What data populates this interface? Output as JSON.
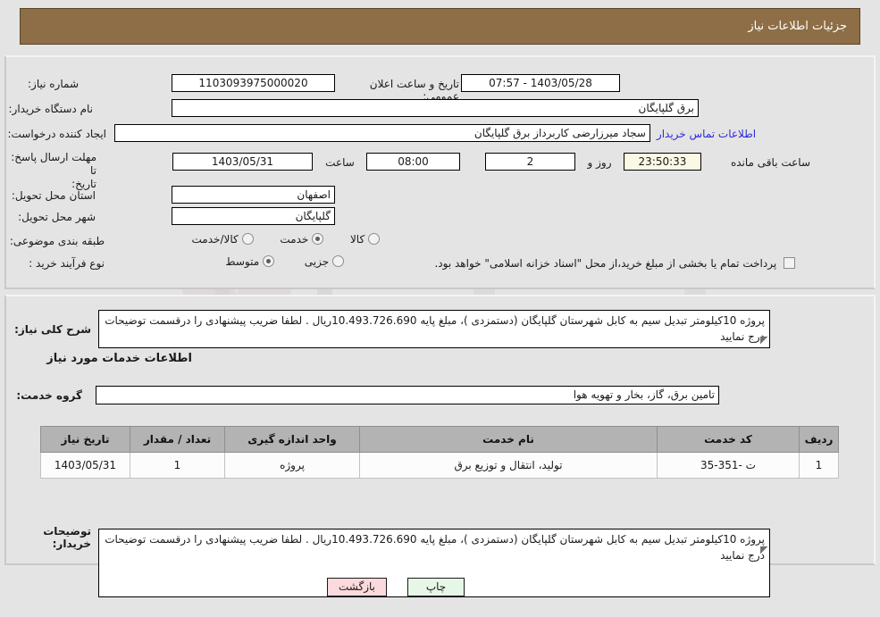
{
  "header": {
    "title": "جزئیات اطلاعات نیاز",
    "bar_color": "#8d6e46"
  },
  "form": {
    "need_number_label": "شماره نیاز:",
    "need_number_value": "1103093975000020",
    "public_announce_label": "تاریخ و ساعت اعلان عمومی:",
    "public_announce_value": "1403/05/28 - 07:57",
    "buyer_org_label": "نام دستگاه خریدار:",
    "buyer_org_value": "برق گلپایگان",
    "requester_label": "ایجاد کننده درخواست:",
    "requester_value": "سجاد میرزارضی کاربرداز برق گلپایگان",
    "buyer_contact_link": "اطلاعات تماس خریدار",
    "deadline_label_line1": "مهلت ارسال پاسخ: تا",
    "deadline_label_line2": "تاریخ:",
    "deadline_date": "1403/05/31",
    "hour_label": "ساعت",
    "deadline_time": "08:00",
    "days_value": "2",
    "days_label": "روز و",
    "countdown_value": "23:50:33",
    "countdown_label": "ساعت باقی مانده",
    "province_label": "استان محل تحویل:",
    "province_value": "اصفهان",
    "city_label": "شهر محل تحویل:",
    "city_value": "گلپایگان",
    "category_label": "طبقه بندی موضوعی:",
    "category_options": [
      {
        "label": "کالا",
        "selected": false
      },
      {
        "label": "خدمت",
        "selected": true
      },
      {
        "label": "کالا/خدمت",
        "selected": false
      }
    ],
    "process_type_label": "نوع فرآیند خرید :",
    "process_type_options": [
      {
        "label": "جزیی",
        "selected": false
      },
      {
        "label": "متوسط",
        "selected": true
      }
    ],
    "treasury_checkbox_checked": false,
    "treasury_checkbox_label": "پرداخت تمام یا بخشی از مبلغ خرید،از محل \"اسناد خزانه اسلامی\" خواهد بود."
  },
  "description": {
    "label": "شرح کلی نیاز:",
    "value": "پروژه 10کیلومتر تبدیل سیم به کابل شهرستان گلپایگان (دستمزدی )،  مبلغ پایه 10.493.726.690ریال . لطفا ضریب پیشنهادی را درقسمت توضیحات درج نمایید"
  },
  "services_section": {
    "heading": "اطلاعات خدمات مورد نیاز",
    "service_group_label": "گروه خدمت:",
    "service_group_value": "تامین برق، گاز، بخار و تهویه هوا",
    "table": {
      "columns": [
        "ردیف",
        "کد خدمت",
        "نام خدمت",
        "واحد اندازه گیری",
        "تعداد / مقدار",
        "تاریخ نیاز"
      ],
      "rows": [
        [
          "1",
          "ت -351-35",
          "تولید، انتقال و توزیع برق",
          "پروژه",
          "1",
          "1403/05/31"
        ]
      ]
    }
  },
  "buyer_notes": {
    "label": "توضیحات خریدار:",
    "value": "پروژه 10کیلومتر تبدیل سیم به کابل شهرستان گلپایگان (دستمزدی )،  مبلغ پایه 10.493.726.690ریال . لطفا ضریب پیشنهادی را درقسمت توضیحات درج نمایید"
  },
  "footer": {
    "print_label": "چاپ",
    "back_label": "بازگشت"
  },
  "watermark": {
    "text": "AriaTender.net"
  }
}
